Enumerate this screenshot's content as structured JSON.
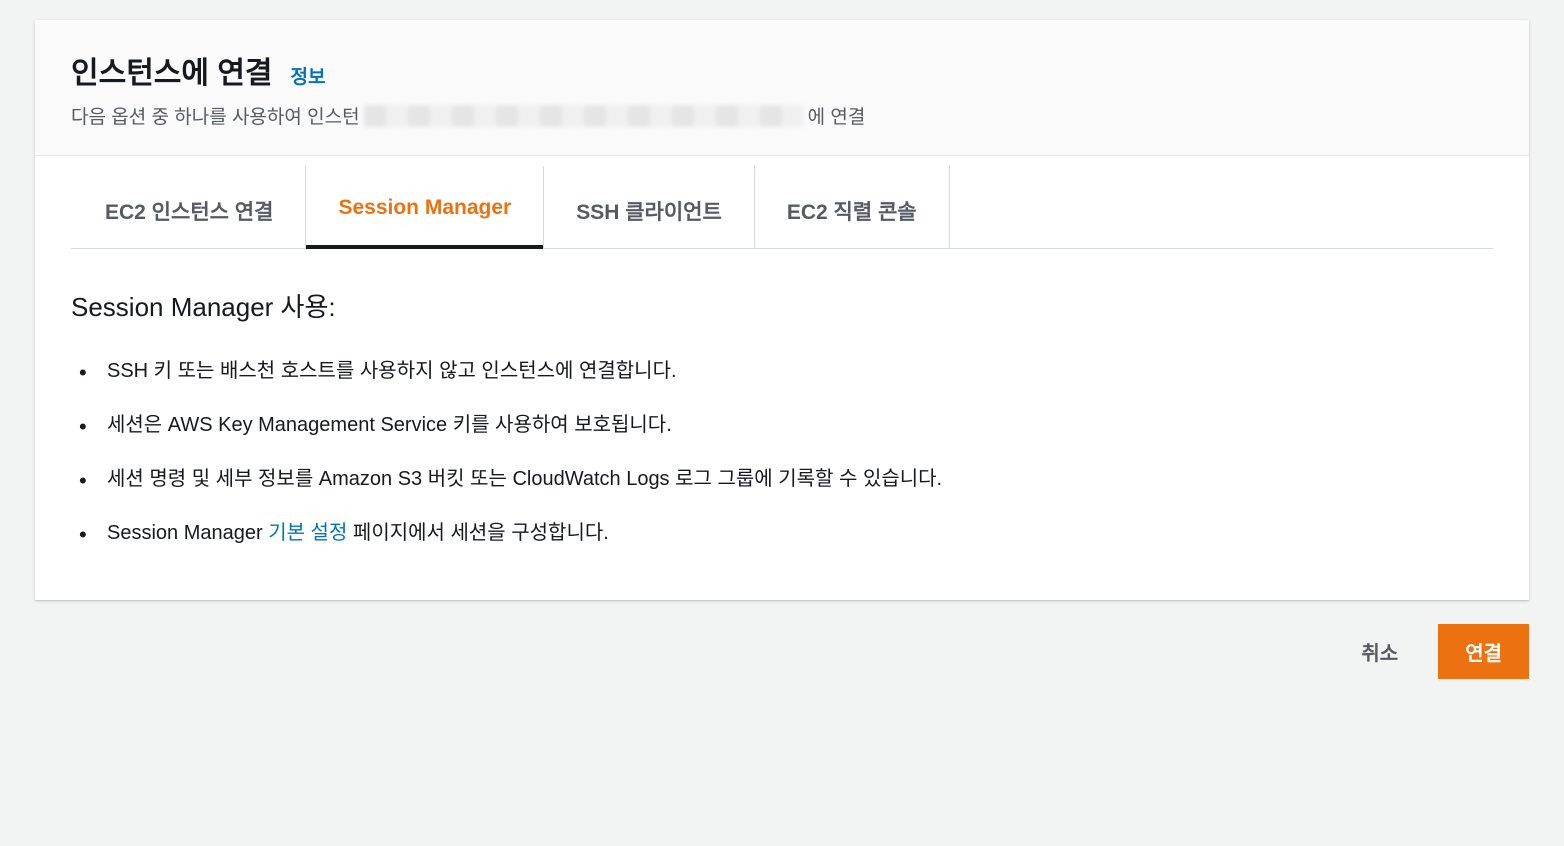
{
  "header": {
    "title": "인스턴스에 연결",
    "info_link": "정보",
    "subtitle_prefix": "다음 옵션 중 하나를 사용하여 인스턴",
    "subtitle_suffix": "에 연결"
  },
  "tabs": [
    {
      "label": "EC2 인스턴스 연결",
      "active": false
    },
    {
      "label": "Session Manager",
      "active": true
    },
    {
      "label": "SSH 클라이언트",
      "active": false
    },
    {
      "label": "EC2 직렬 콘솔",
      "active": false
    }
  ],
  "content": {
    "heading": "Session Manager 사용:",
    "bullets": [
      {
        "text": "SSH 키 또는 배스천 호스트를 사용하지 않고 인스턴스에 연결합니다."
      },
      {
        "text": "세션은 AWS Key Management Service 키를 사용하여 보호됩니다."
      },
      {
        "text": "세션 명령 및 세부 정보를 Amazon S3 버킷 또는 CloudWatch Logs 로그 그룹에 기록할 수 있습니다."
      },
      {
        "prefix": "Session Manager ",
        "link": "기본 설정",
        "suffix": " 페이지에서 세션을 구성합니다."
      }
    ]
  },
  "actions": {
    "cancel": "취소",
    "connect": "연결"
  }
}
